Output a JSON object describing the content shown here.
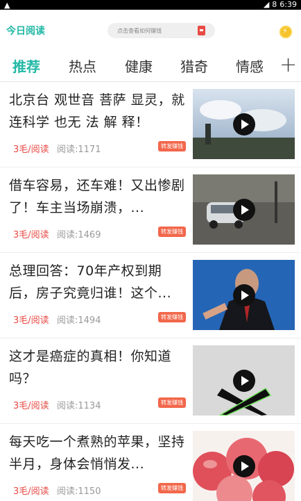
{
  "status_bar": {
    "time": "6:39",
    "battery_level": "8"
  },
  "header": {
    "app_title": "今日阅读",
    "search_placeholder": "点击查看如何赚钱",
    "icons": [
      "gift-icon",
      "coin-icon"
    ]
  },
  "tabs": [
    {
      "label": "推荐",
      "active": true
    },
    {
      "label": "热点"
    },
    {
      "label": "健康"
    },
    {
      "label": "猎奇"
    },
    {
      "label": "情感"
    }
  ],
  "add_tab_label": "+",
  "articles": [
    {
      "title": "北京台 观世音 菩萨 显灵，就连科学 也无 法 解 释！",
      "price": "3毛/阅读",
      "reads": "阅读:1171",
      "share": "转发赚钱",
      "thumb": "sky-photo"
    },
    {
      "title": "借车容易，还车难！又出惨剧了！车主当场崩溃，...",
      "price": "3毛/阅读",
      "reads": "阅读:1469",
      "share": "转发赚钱",
      "thumb": "car-photo"
    },
    {
      "title": "总理回答：70年产权到期后，房子究竟归谁！这个...",
      "price": "3毛/阅读",
      "reads": "阅读:1494",
      "share": "转发赚钱",
      "thumb": "speaker-photo"
    },
    {
      "title": "这才是癌症的真相！你知道吗？",
      "price": "3毛/阅读",
      "reads": "阅读:1134",
      "share": "转发赚钱",
      "thumb": "cross-arms-photo"
    },
    {
      "title": "每天吃一个煮熟的苹果，坚持半月，身体会悄悄发...",
      "price": "3毛/阅读",
      "reads": "阅读:1150",
      "share": "转发赚钱",
      "thumb": "apples-photo"
    }
  ],
  "colors": {
    "accent": "#22b8a6",
    "price": "#e84a45",
    "share_badge": "#f2674b"
  }
}
